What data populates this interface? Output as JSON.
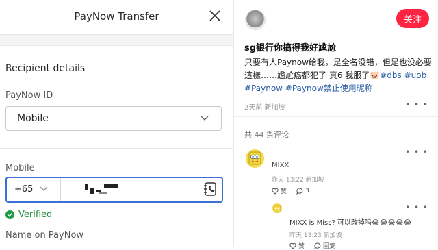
{
  "left_panel": {
    "title": "PayNow Transfer",
    "section_title": "Recipient details",
    "paynow_id_label": "PayNow ID",
    "paynow_id_value": "Mobile",
    "mobile_label": "Mobile",
    "country_code": "+65",
    "verified_text": "Verified",
    "name_label": "Name on PayNow"
  },
  "right_panel": {
    "follow_label": "关注",
    "post_title": "sg银行你搞得我好尴尬",
    "post_body": "只要有人Paynow给我，是全名没错，但是也没必要這樣……尷尬癌都犯了 真6 我服了",
    "tags": [
      "#dbs",
      "#uob",
      "#Paynow",
      "#Paynow禁止使用昵称"
    ],
    "post_meta": "2天前 新加坡",
    "comment_count": "共 44 条评论",
    "comments": [
      {
        "name": "MIXX",
        "meta": "昨天 13:22 新加坡",
        "like_label": "赞",
        "reply_count": "3"
      },
      {
        "text": "MIXX is Miss? 可以改掉吗😂😂😂😂😂",
        "meta": "昨天 13:23 新加坡",
        "like_label": "赞",
        "reply_label": "回复"
      }
    ]
  },
  "colors": {
    "accent_blue": "#3b6fd6",
    "verified_green": "#1f8a3a",
    "follow_red": "#ff2442",
    "tag_blue": "#2b5ea7"
  }
}
